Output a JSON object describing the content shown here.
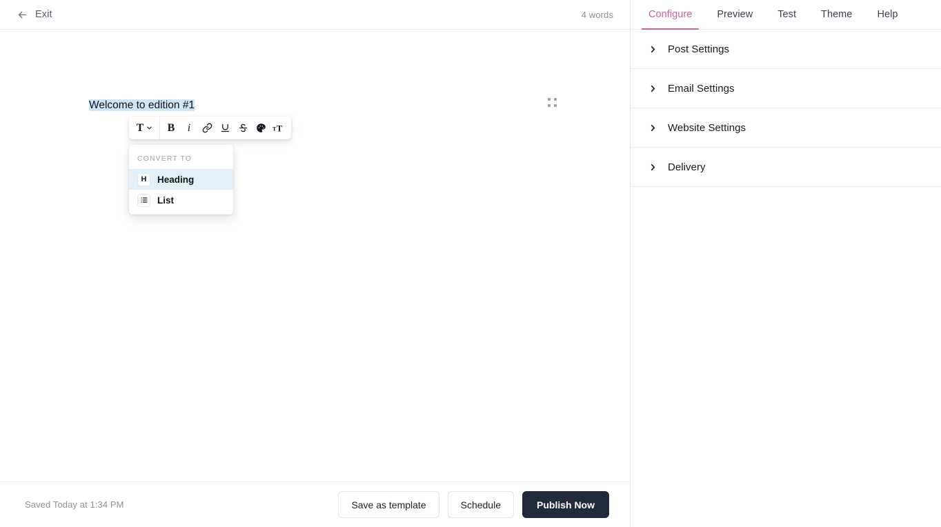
{
  "editor": {
    "header": {
      "exit_label": "Exit",
      "word_count": "4 words"
    },
    "document": {
      "title_block": "Welcome to edition #1"
    },
    "toolbar": {
      "style_label": "T",
      "bold_label": "B",
      "italic_label": "i",
      "items": [
        "text-style-dropdown",
        "bold",
        "italic",
        "link",
        "underline",
        "strikethrough",
        "text-color",
        "font-size"
      ]
    },
    "convert_menu": {
      "heading_title": "CONVERT TO",
      "items": [
        {
          "icon_label": "H",
          "label": "Heading",
          "active": true
        },
        {
          "icon_label": "list",
          "label": "List",
          "active": false
        }
      ]
    },
    "footer": {
      "saved_status": "Saved Today at 1:34 PM",
      "save_template_label": "Save as template",
      "schedule_label": "Schedule",
      "publish_label": "Publish Now"
    }
  },
  "config": {
    "tabs": [
      {
        "label": "Configure",
        "active": true
      },
      {
        "label": "Preview",
        "active": false
      },
      {
        "label": "Test",
        "active": false
      },
      {
        "label": "Theme",
        "active": false
      },
      {
        "label": "Help",
        "active": false
      }
    ],
    "sections": [
      {
        "label": "Post Settings"
      },
      {
        "label": "Email Settings"
      },
      {
        "label": "Website Settings"
      },
      {
        "label": "Delivery"
      }
    ]
  },
  "colors": {
    "accent_pink": "#d06096",
    "primary_dark": "#212b3b",
    "selection_blue": "#cfe5f8",
    "menu_active_blue": "#e3f0f8"
  }
}
